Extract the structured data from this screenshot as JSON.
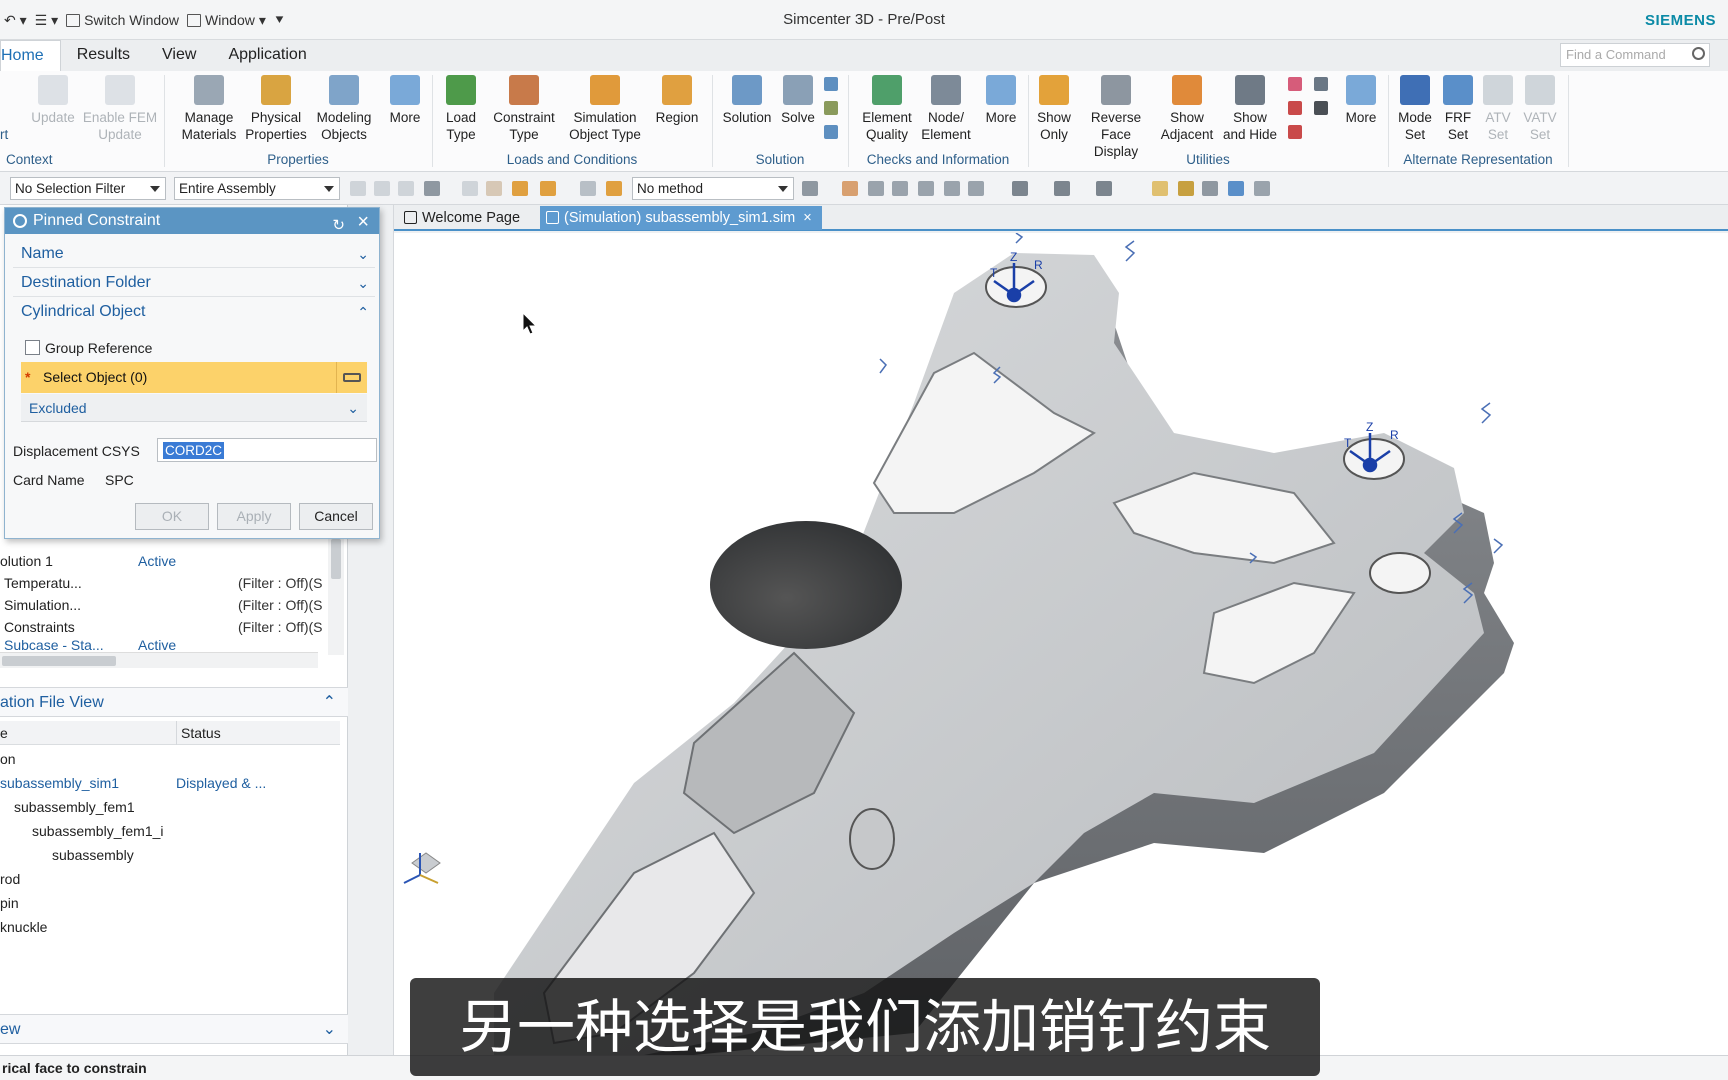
{
  "window": {
    "title": "Simcenter 3D - Pre/Post",
    "brand": "SIEMENS"
  },
  "qat": {
    "switch_window": "Switch Window",
    "window_menu": "Window"
  },
  "menu": {
    "tabs": [
      "Home",
      "Results",
      "View",
      "Application"
    ],
    "find_placeholder": "Find a Command"
  },
  "ribbon": {
    "buttons": [
      {
        "label": "Update",
        "disabled": true
      },
      {
        "label": "Enable FEM Update",
        "disabled": true
      },
      {
        "label": "Manage Materials"
      },
      {
        "label": "Physical Properties"
      },
      {
        "label": "Modeling Objects"
      },
      {
        "label": "More"
      },
      {
        "label": "Load Type"
      },
      {
        "label": "Constraint Type"
      },
      {
        "label": "Simulation Object Type"
      },
      {
        "label": "Region"
      },
      {
        "label": "Solution"
      },
      {
        "label": "Solve"
      },
      {
        "label": "Element Quality"
      },
      {
        "label": "Node/ Element"
      },
      {
        "label": "More"
      },
      {
        "label": "Show Only"
      },
      {
        "label": "Reverse Face Display"
      },
      {
        "label": "Show Adjacent"
      },
      {
        "label": "Show and Hide"
      },
      {
        "label": "More"
      },
      {
        "label": "Mode Set"
      },
      {
        "label": "FRF Set"
      },
      {
        "label": "ATV Set",
        "disabled": true
      },
      {
        "label": "VATV Set",
        "disabled": true
      }
    ],
    "groups": [
      "Context",
      "Properties",
      "Loads and Conditions",
      "Solution",
      "Checks and Information",
      "Utilities",
      "Alternate Representation"
    ],
    "context_fragment": "rt"
  },
  "selection_bar": {
    "filter": "No Selection Filter",
    "scope": "Entire Assembly",
    "method": "No method"
  },
  "dialog": {
    "title": "Pinned Constraint",
    "sections": {
      "name": "Name",
      "destination": "Destination Folder",
      "cylindrical": "Cylindrical Object"
    },
    "group_reference": "Group Reference",
    "select_object": "Select Object (0)",
    "excluded": "Excluded",
    "displacement_csys_label": "Displacement CSYS",
    "displacement_csys_value": "CORD2C",
    "card_name_label": "Card Name",
    "card_name_value": "SPC",
    "buttons": {
      "ok": "OK",
      "apply": "Apply",
      "cancel": "Cancel"
    }
  },
  "navigator": {
    "rows": [
      {
        "c1": "olution 1",
        "c2": "Active",
        "c3": ""
      },
      {
        "c1": "Temperatu...",
        "c2": "",
        "c3": "(Filter : Off)(S"
      },
      {
        "c1": "Simulation...",
        "c2": "",
        "c3": "(Filter : Off)(S"
      },
      {
        "c1": "Constraints",
        "c2": "",
        "c3": "(Filter : Off)(S"
      },
      {
        "c1": "Subcase - Sta...",
        "c2": "Active",
        "c3": ""
      }
    ],
    "file_view_title": "ation File View",
    "columns": [
      "e",
      "Status"
    ],
    "files": [
      {
        "name": "on",
        "status": ""
      },
      {
        "name": "subassembly_sim1",
        "status": "Displayed & ..."
      },
      {
        "name": "subassembly_fem1",
        "status": ""
      },
      {
        "name": "subassembly_fem1_i",
        "status": ""
      },
      {
        "name": "subassembly",
        "status": ""
      },
      {
        "name": "rod",
        "status": ""
      },
      {
        "name": "pin",
        "status": ""
      },
      {
        "name": "knuckle",
        "status": ""
      }
    ],
    "bottom_section": "ew"
  },
  "graphics_tabs": {
    "welcome": "Welcome Page",
    "active": "(Simulation) subassembly_sim1.sim"
  },
  "triad_labels": {
    "t": "T",
    "z": "Z",
    "r": "R"
  },
  "status_text": "rical face to constrain",
  "subtitle": "另一种选择是我们添加销钉约束",
  "colors": {
    "accent": "#1f5fa0",
    "dialog_title": "#5b95c3",
    "selection_highlight": "#fcd26a",
    "brand": "#0b8aa6"
  }
}
